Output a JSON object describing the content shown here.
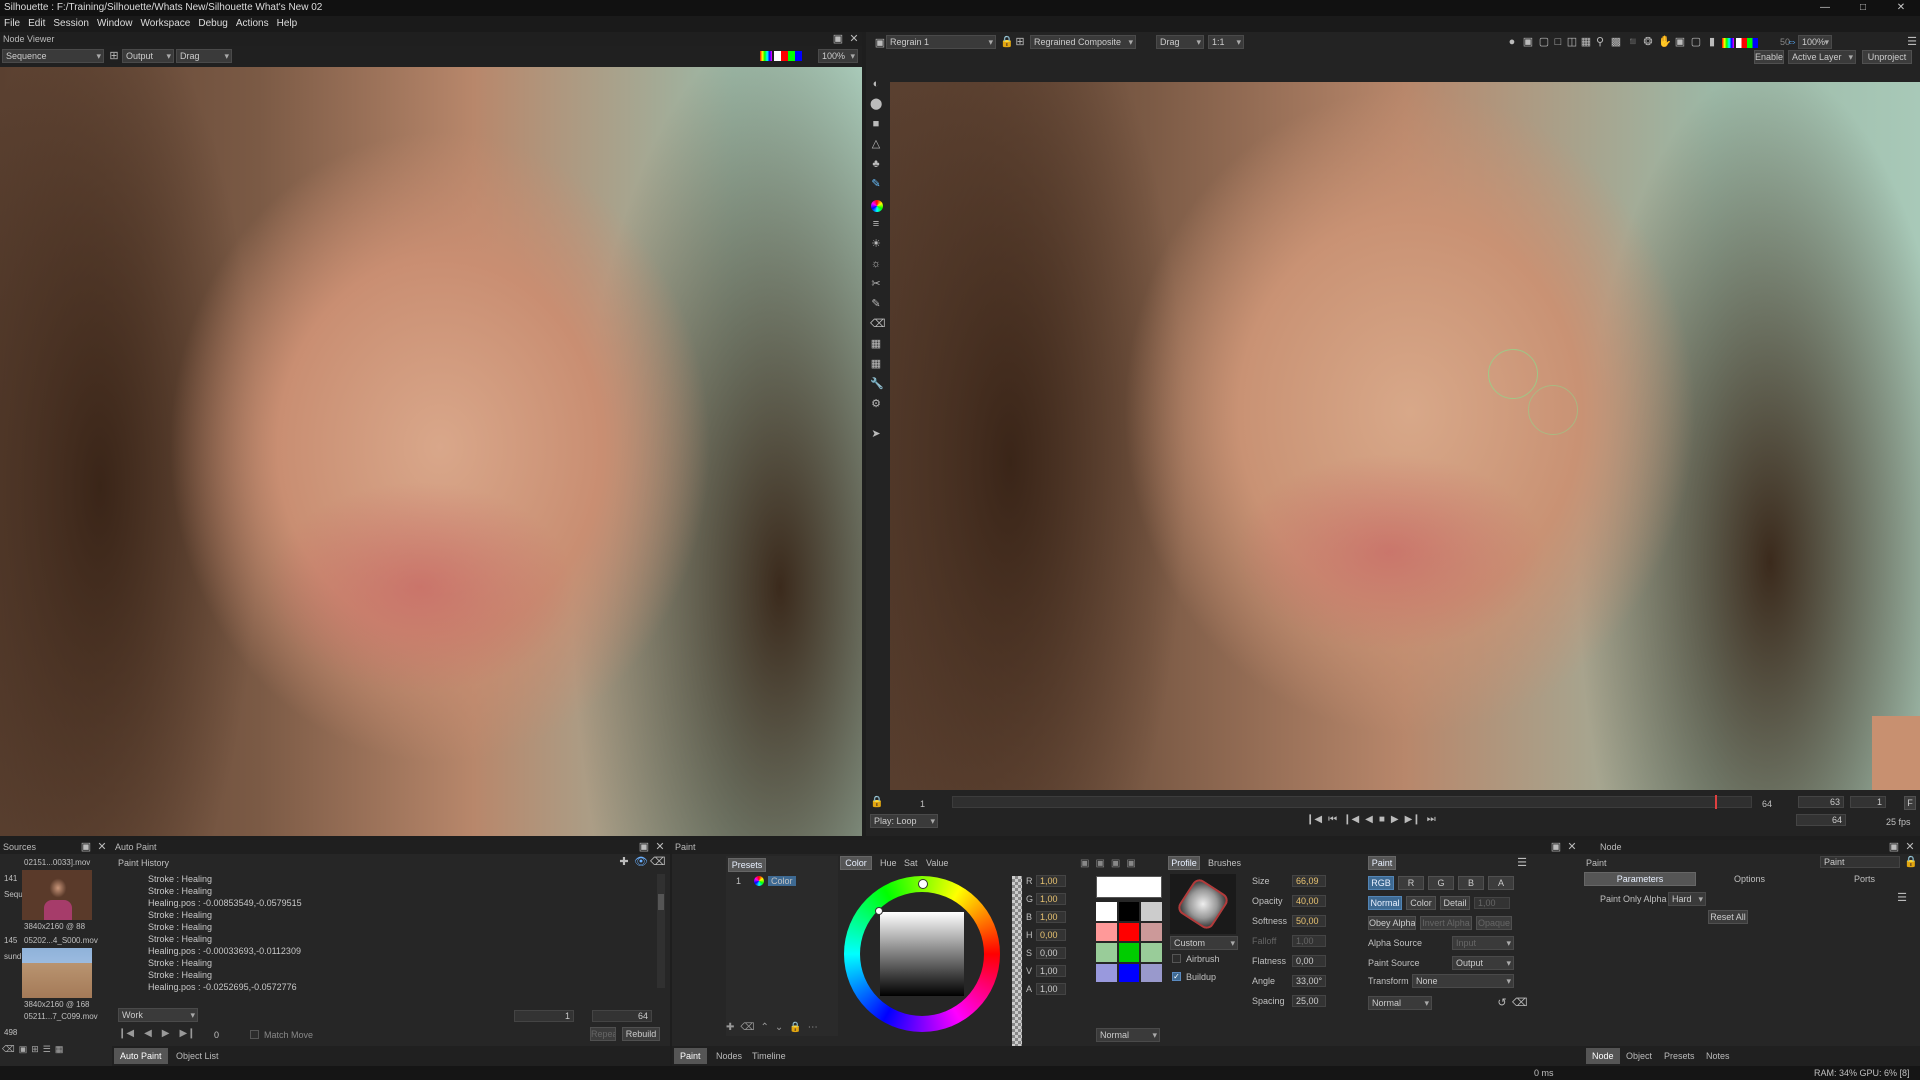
{
  "window": {
    "title": "Silhouette : F:/Training/Silhouette/Whats New/Silhouette What's New 02"
  },
  "menu": [
    "File",
    "Edit",
    "Session",
    "Window",
    "Workspace",
    "Debug",
    "Actions",
    "Help"
  ],
  "node_viewer": {
    "title": "Node Viewer",
    "sequence": "Sequence",
    "output": "Output",
    "drag": "Drag",
    "zoom": "100%"
  },
  "main_viewer": {
    "node": "Regrain 1",
    "composite": "Regrained Composite",
    "drag": "Drag",
    "ratio": "1:1",
    "fifty": "50",
    "zoom": "100%",
    "enable": "Enable",
    "active_layer": "Active Layer",
    "unproject": "Unproject",
    "frame_start": "1",
    "frame_cur": "64",
    "frame_in": "63",
    "frame_out": "1",
    "f_label": "F",
    "play_mode": "Play: Loop",
    "frame_display": "64",
    "fps": "25 fps"
  },
  "sources": {
    "title": "Sources",
    "items": [
      {
        "name": "02151...0033].mov",
        "res": "3840x2160 @ 88",
        "num": "141"
      },
      {
        "name": "05202...4_S000.mov",
        "res": "3840x2160 @ 168",
        "num": "145"
      },
      {
        "name": "05211...7_C099.mov",
        "res": "",
        "num": "498"
      }
    ],
    "seq_label": "Sequ",
    "sund_label": "sund"
  },
  "auto_paint": {
    "title": "Auto Paint",
    "history_title": "Paint History",
    "lines": [
      "Stroke : Healing",
      "Stroke : Healing",
      "Healing.pos : -0.00853549,-0.0579515",
      "Stroke : Healing",
      "Stroke : Healing",
      "Stroke : Healing",
      "Healing.pos : -0.00033693,-0.0112309",
      "Stroke : Healing",
      "Stroke : Healing",
      "Healing.pos : -0.0252695,-0.0572776",
      "Stroke : Healing"
    ],
    "work": "Work",
    "field1": "1",
    "field2": "64",
    "frame": "0",
    "match_move": "Match Move",
    "repeat": "Repeat",
    "rebuild": "Rebuild",
    "tabs": [
      "Auto Paint",
      "Object List"
    ]
  },
  "paint": {
    "title": "Paint",
    "presets": "Presets",
    "preset_row": {
      "num": "1",
      "label": "Color"
    },
    "color_tabs": [
      "Color",
      "Hue",
      "Sat",
      "Value"
    ],
    "channels": [
      {
        "k": "R",
        "v": "1,00"
      },
      {
        "k": "G",
        "v": "1,00"
      },
      {
        "k": "B",
        "v": "1,00"
      },
      {
        "k": "H",
        "v": "0,00"
      },
      {
        "k": "S",
        "v": "0,00"
      },
      {
        "k": "V",
        "v": "1,00"
      },
      {
        "k": "A",
        "v": "1,00"
      }
    ],
    "blend": "Normal",
    "swatch_colors": [
      "#ffffff",
      "#000000",
      "#ffffff",
      "#ff0000",
      "#ff9999",
      "#00aa00",
      "#99cc99",
      "#0000ff",
      "#9999cc",
      "#cccccc"
    ],
    "profile": "Profile",
    "brushes": "Brushes",
    "brush_preset": "Custom",
    "airbrush": "Airbrush",
    "buildup": "Buildup",
    "props": [
      {
        "k": "Size",
        "v": "66,09"
      },
      {
        "k": "Opacity",
        "v": "40,00"
      },
      {
        "k": "Softness",
        "v": "50,00"
      },
      {
        "k": "Falloff",
        "v": "1,00"
      },
      {
        "k": "Flatness",
        "v": "0,00"
      },
      {
        "k": "Angle",
        "v": "33,00°"
      },
      {
        "k": "Spacing",
        "v": "25,00"
      }
    ],
    "mode_tab": "Paint",
    "channels_btns": [
      "RGB",
      "R",
      "G",
      "B",
      "A"
    ],
    "mode_btns": [
      "Normal",
      "Color",
      "Detail"
    ],
    "detail_val": "1,00",
    "obey_alpha": "Obey Alpha",
    "invert_alpha": "Invert Alpha",
    "opaque": "Opaque",
    "alpha_source": "Alpha Source",
    "alpha_source_val": "Input",
    "paint_source": "Paint Source",
    "paint_source_val": "Output",
    "transform": "Transform",
    "transform_val": "None",
    "mode_val": "Normal",
    "bottom_tabs": [
      "Paint",
      "Nodes",
      "Timeline"
    ]
  },
  "node_panel": {
    "title": "Node",
    "node_label": "Paint",
    "node_name": "Paint",
    "tabs": [
      "Parameters",
      "Options",
      "Ports"
    ],
    "paint_only_alpha": "Paint Only Alpha",
    "hard": "Hard",
    "reset_all": "Reset All",
    "bottom_tabs": [
      "Node",
      "Object",
      "Presets",
      "Notes"
    ]
  },
  "status": {
    "ms": "0 ms",
    "ram": "RAM: 34% GPU: 6% [8]"
  }
}
